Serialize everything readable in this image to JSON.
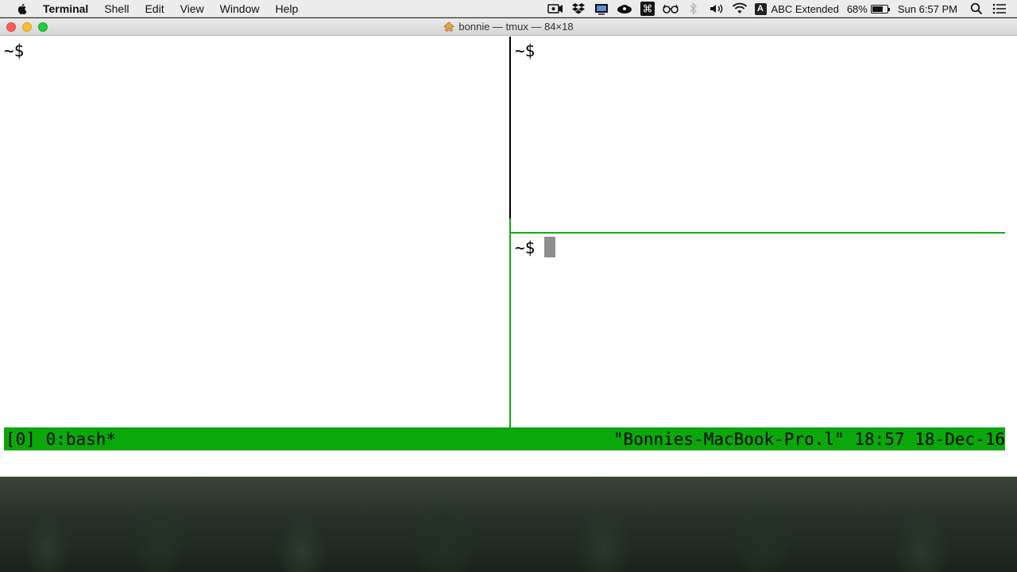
{
  "menubar": {
    "app_name": "Terminal",
    "items": [
      "Shell",
      "Edit",
      "View",
      "Window",
      "Help"
    ],
    "status": {
      "icons": [
        "facetime-camera-icon",
        "dropbox-icon",
        "display-icon",
        "cloud-app-icon",
        "command-key-icon",
        "reading-glasses-icon",
        "bluetooth-icon",
        "volume-icon",
        "wifi-icon"
      ],
      "input_badge": "A",
      "input_source": "ABC Extended",
      "battery_percent": "68%",
      "battery_level": 0.68,
      "clock": "Sun 6:57 PM"
    }
  },
  "window": {
    "title": "bonnie — tmux — 84×18"
  },
  "panes": {
    "left": {
      "prompt": "~$"
    },
    "top_right": {
      "prompt": "~$"
    },
    "bottom_right": {
      "prompt": "~$"
    }
  },
  "tmux": {
    "left": "[0] 0:bash*",
    "right": "\"Bonnies-MacBook-Pro.l\" 18:57 18-Dec-16"
  },
  "colors": {
    "tmux_green": "#0aa80a",
    "active_border": "#18a818",
    "cursor": "#8e8e8e"
  }
}
